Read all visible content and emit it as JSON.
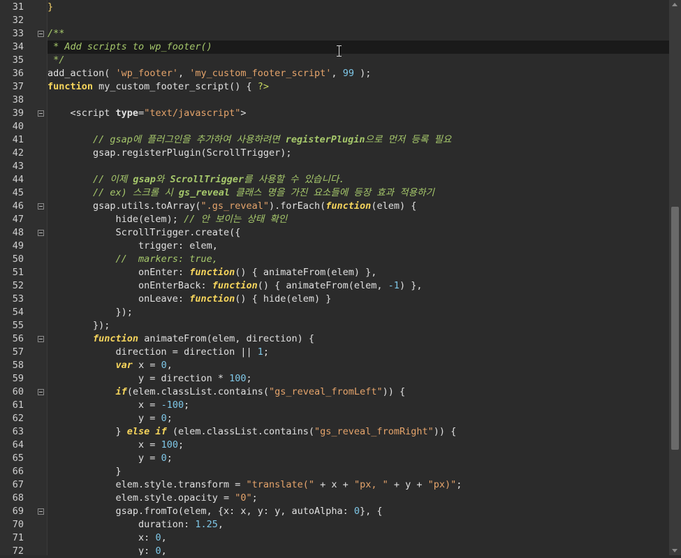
{
  "editor": {
    "line_numbers": [
      "31",
      "32",
      "33",
      "34",
      "35",
      "36",
      "37",
      "38",
      "39",
      "40",
      "41",
      "42",
      "43",
      "44",
      "45",
      "46",
      "47",
      "48",
      "49",
      "50",
      "51",
      "52",
      "53",
      "54",
      "55",
      "56",
      "57",
      "58",
      "59",
      "60",
      "61",
      "62",
      "63",
      "64",
      "65",
      "66",
      "67",
      "68",
      "69",
      "70",
      "71",
      "72"
    ],
    "colors": {
      "background": "#2b2b2b",
      "gutter": "#2f2f2f",
      "current_line": "#1a1a1a",
      "keyword": "#f6d55c",
      "string": "#e5a46b",
      "number": "#7fc8e8",
      "comment": "#a6c86b"
    },
    "lines": [
      [
        [
          "p",
          "}"
        ]
      ],
      [],
      [
        [
          "c",
          "/**"
        ]
      ],
      [
        [
          "c",
          " * Add scripts to wp_footer()"
        ]
      ],
      [
        [
          "c",
          " */"
        ]
      ],
      [
        [
          "t",
          "add_action( "
        ],
        [
          "s",
          "'wp_footer'"
        ],
        [
          "t",
          ", "
        ],
        [
          "s",
          "'my_custom_footer_script'"
        ],
        [
          "t",
          ", "
        ],
        [
          "n",
          "99"
        ],
        [
          "t",
          " );"
        ]
      ],
      [
        [
          "kw",
          "function"
        ],
        [
          "t",
          " my_custom_footer_script() { "
        ],
        [
          "php",
          "?>"
        ]
      ],
      [],
      [
        [
          "t",
          "    <script "
        ],
        [
          "attr",
          "type"
        ],
        [
          "t",
          "="
        ],
        [
          "s",
          "\"text/javascript\""
        ],
        [
          "t",
          ">"
        ]
      ],
      [],
      [
        [
          "t",
          "        "
        ],
        [
          "c",
          "// gsap에 플러그인을 추가하여 사용하려면 "
        ],
        [
          "cb",
          "registerPlugin"
        ],
        [
          "c",
          "으로 먼저 등록 필요"
        ]
      ],
      [
        [
          "t",
          "        gsap.registerPlugin(ScrollTrigger);"
        ]
      ],
      [],
      [
        [
          "t",
          "        "
        ],
        [
          "c",
          "// 이제 "
        ],
        [
          "cb",
          "gsap"
        ],
        [
          "c",
          "와 "
        ],
        [
          "cb",
          "ScrollTrigger"
        ],
        [
          "c",
          "를 사용할 수 있습니다."
        ]
      ],
      [
        [
          "t",
          "        "
        ],
        [
          "c",
          "// ex) 스크롤 시 "
        ],
        [
          "cb",
          "gs_reveal"
        ],
        [
          "c",
          " 클래스 명을 가진 요소들에 등장 효과 적용하기"
        ]
      ],
      [
        [
          "t",
          "        gsap.utils.toArray("
        ],
        [
          "s",
          "\".gs_reveal\""
        ],
        [
          "t",
          ").forEach("
        ],
        [
          "k",
          "function"
        ],
        [
          "t",
          "(elem) {"
        ]
      ],
      [
        [
          "t",
          "            hide(elem); "
        ],
        [
          "c",
          "// 안 보이는 상태 확인"
        ]
      ],
      [
        [
          "t",
          "            ScrollTrigger.create({"
        ]
      ],
      [
        [
          "t",
          "                trigger: elem,"
        ]
      ],
      [
        [
          "t",
          "            "
        ],
        [
          "c",
          "//  markers: true,"
        ]
      ],
      [
        [
          "t",
          "                onEnter: "
        ],
        [
          "k",
          "function"
        ],
        [
          "t",
          "() { animateFrom(elem) },"
        ]
      ],
      [
        [
          "t",
          "                onEnterBack: "
        ],
        [
          "k",
          "function"
        ],
        [
          "t",
          "() { animateFrom(elem, "
        ],
        [
          "n",
          "-1"
        ],
        [
          "t",
          ") },"
        ]
      ],
      [
        [
          "t",
          "                onLeave: "
        ],
        [
          "k",
          "function"
        ],
        [
          "t",
          "() { hide(elem) }"
        ]
      ],
      [
        [
          "t",
          "            });"
        ]
      ],
      [
        [
          "t",
          "        });"
        ]
      ],
      [
        [
          "t",
          "        "
        ],
        [
          "k",
          "function"
        ],
        [
          "t",
          " animateFrom(elem, direction) {"
        ]
      ],
      [
        [
          "t",
          "            direction = direction || "
        ],
        [
          "n",
          "1"
        ],
        [
          "t",
          ";"
        ]
      ],
      [
        [
          "t",
          "            "
        ],
        [
          "k",
          "var"
        ],
        [
          "t",
          " x = "
        ],
        [
          "n",
          "0"
        ],
        [
          "t",
          ","
        ]
      ],
      [
        [
          "t",
          "                y = direction * "
        ],
        [
          "n",
          "100"
        ],
        [
          "t",
          ";"
        ]
      ],
      [
        [
          "t",
          "            "
        ],
        [
          "k",
          "if"
        ],
        [
          "t",
          "(elem.classList.contains("
        ],
        [
          "s",
          "\"gs_reveal_fromLeft\""
        ],
        [
          "t",
          ")) {"
        ]
      ],
      [
        [
          "t",
          "                x = "
        ],
        [
          "n",
          "-100"
        ],
        [
          "t",
          ";"
        ]
      ],
      [
        [
          "t",
          "                y = "
        ],
        [
          "n",
          "0"
        ],
        [
          "t",
          ";"
        ]
      ],
      [
        [
          "t",
          "            } "
        ],
        [
          "k",
          "else if"
        ],
        [
          "t",
          " (elem.classList.contains("
        ],
        [
          "s",
          "\"gs_reveal_fromRight\""
        ],
        [
          "t",
          ")) {"
        ]
      ],
      [
        [
          "t",
          "                x = "
        ],
        [
          "n",
          "100"
        ],
        [
          "t",
          ";"
        ]
      ],
      [
        [
          "t",
          "                y = "
        ],
        [
          "n",
          "0"
        ],
        [
          "t",
          ";"
        ]
      ],
      [
        [
          "t",
          "            }"
        ]
      ],
      [
        [
          "t",
          "            elem.style.transform = "
        ],
        [
          "s",
          "\"translate(\""
        ],
        [
          "t",
          " + x + "
        ],
        [
          "s",
          "\"px, \""
        ],
        [
          "t",
          " + y + "
        ],
        [
          "s",
          "\"px)\""
        ],
        [
          "t",
          ";"
        ]
      ],
      [
        [
          "t",
          "            elem.style.opacity = "
        ],
        [
          "s",
          "\"0\""
        ],
        [
          "t",
          ";"
        ]
      ],
      [
        [
          "t",
          "            gsap.fromTo(elem, {x: x, y: y, autoAlpha: "
        ],
        [
          "n",
          "0"
        ],
        [
          "t",
          "}, {"
        ]
      ],
      [
        [
          "t",
          "                duration: "
        ],
        [
          "n",
          "1.25"
        ],
        [
          "t",
          ","
        ]
      ],
      [
        [
          "t",
          "                x: "
        ],
        [
          "n",
          "0"
        ],
        [
          "t",
          ","
        ]
      ],
      [
        [
          "t",
          "                y: "
        ],
        [
          "n",
          "0"
        ],
        [
          "t",
          ","
        ]
      ]
    ]
  }
}
